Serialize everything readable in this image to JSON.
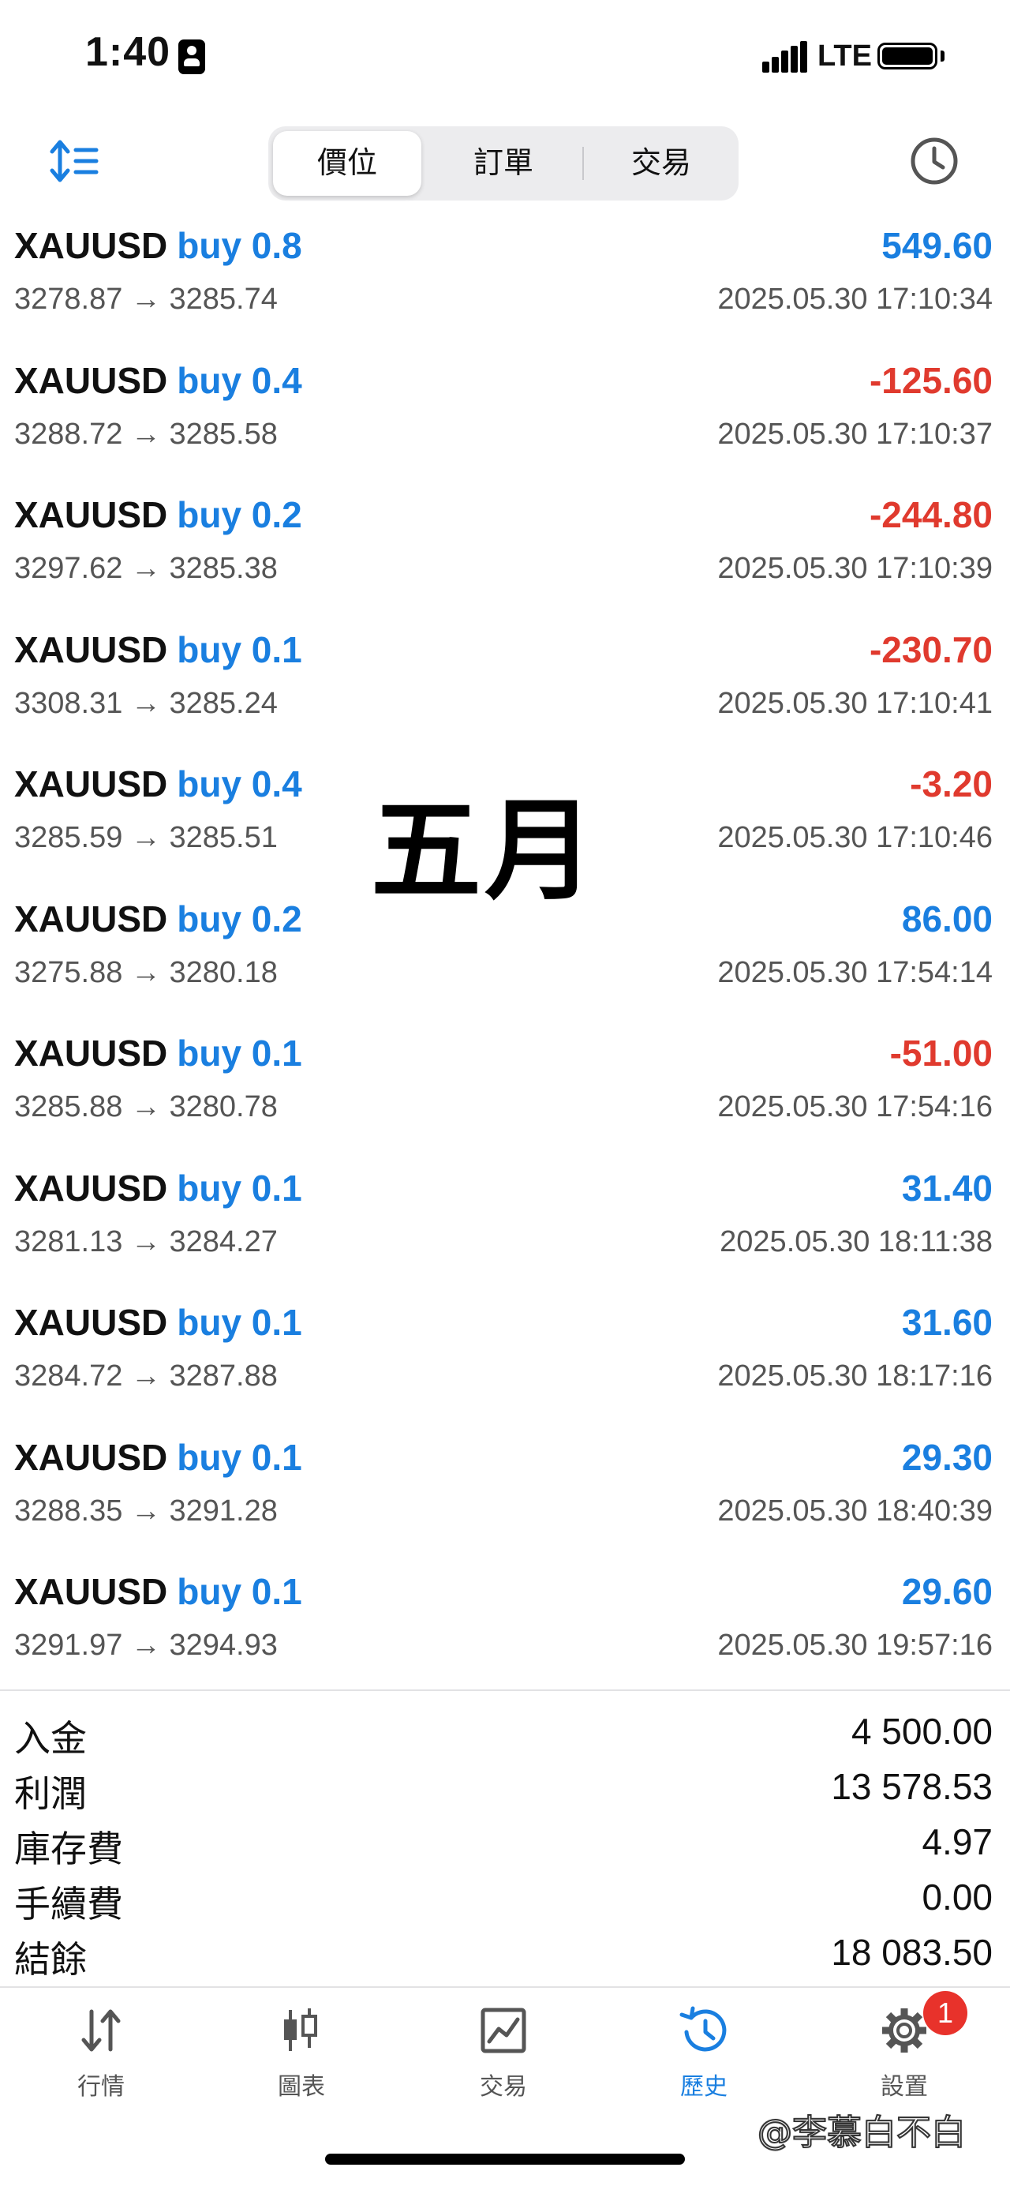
{
  "status_bar": {
    "time": "1:40",
    "network": "LTE"
  },
  "toolbar": {
    "segments": [
      "價位",
      "訂單",
      "交易"
    ],
    "active_segment": 0
  },
  "trades": [
    {
      "symbol": "XAUUSD",
      "side": "buy 0.8",
      "prices": "3278.87 → 3285.74",
      "profit": "549.60",
      "time": "2025.05.30 17:10:34",
      "positive": true
    },
    {
      "symbol": "XAUUSD",
      "side": "buy 0.4",
      "prices": "3288.72 → 3285.58",
      "profit": "-125.60",
      "time": "2025.05.30 17:10:37",
      "positive": false
    },
    {
      "symbol": "XAUUSD",
      "side": "buy 0.2",
      "prices": "3297.62 → 3285.38",
      "profit": "-244.80",
      "time": "2025.05.30 17:10:39",
      "positive": false
    },
    {
      "symbol": "XAUUSD",
      "side": "buy 0.1",
      "prices": "3308.31 → 3285.24",
      "profit": "-230.70",
      "time": "2025.05.30 17:10:41",
      "positive": false
    },
    {
      "symbol": "XAUUSD",
      "side": "buy 0.4",
      "prices": "3285.59 → 3285.51",
      "profit": "-3.20",
      "time": "2025.05.30 17:10:46",
      "positive": false
    },
    {
      "symbol": "XAUUSD",
      "side": "buy 0.2",
      "prices": "3275.88 → 3280.18",
      "profit": "86.00",
      "time": "2025.05.30 17:54:14",
      "positive": true
    },
    {
      "symbol": "XAUUSD",
      "side": "buy 0.1",
      "prices": "3285.88 → 3280.78",
      "profit": "-51.00",
      "time": "2025.05.30 17:54:16",
      "positive": false
    },
    {
      "symbol": "XAUUSD",
      "side": "buy 0.1",
      "prices": "3281.13 → 3284.27",
      "profit": "31.40",
      "time": "2025.05.30 18:11:38",
      "positive": true
    },
    {
      "symbol": "XAUUSD",
      "side": "buy 0.1",
      "prices": "3284.72 → 3287.88",
      "profit": "31.60",
      "time": "2025.05.30 18:17:16",
      "positive": true
    },
    {
      "symbol": "XAUUSD",
      "side": "buy 0.1",
      "prices": "3288.35 → 3291.28",
      "profit": "29.30",
      "time": "2025.05.30 18:40:39",
      "positive": true
    },
    {
      "symbol": "XAUUSD",
      "side": "buy 0.1",
      "prices": "3291.97 → 3294.93",
      "profit": "29.60",
      "time": "2025.05.30 19:57:16",
      "positive": true
    }
  ],
  "overlay_text": "五月",
  "summary": [
    {
      "label": "入金",
      "value": "4 500.00"
    },
    {
      "label": "利潤",
      "value": "13 578.53"
    },
    {
      "label": "庫存費",
      "value": "4.97"
    },
    {
      "label": "手續費",
      "value": "0.00"
    },
    {
      "label": "結餘",
      "value": "18 083.50"
    }
  ],
  "tabbar": {
    "tabs": [
      {
        "label": "行情",
        "icon": "quotes-arrows-icon"
      },
      {
        "label": "圖表",
        "icon": "candlestick-icon"
      },
      {
        "label": "交易",
        "icon": "trade-chart-icon"
      },
      {
        "label": "歷史",
        "icon": "history-clock-icon"
      },
      {
        "label": "設置",
        "icon": "gear-icon"
      }
    ],
    "active_tab": 3,
    "settings_badge": "1"
  },
  "credit_watermark": "@李慕白不白",
  "colors": {
    "accent": "#1a7fe0",
    "loss": "#e03a2e",
    "badge": "#e8322b"
  }
}
